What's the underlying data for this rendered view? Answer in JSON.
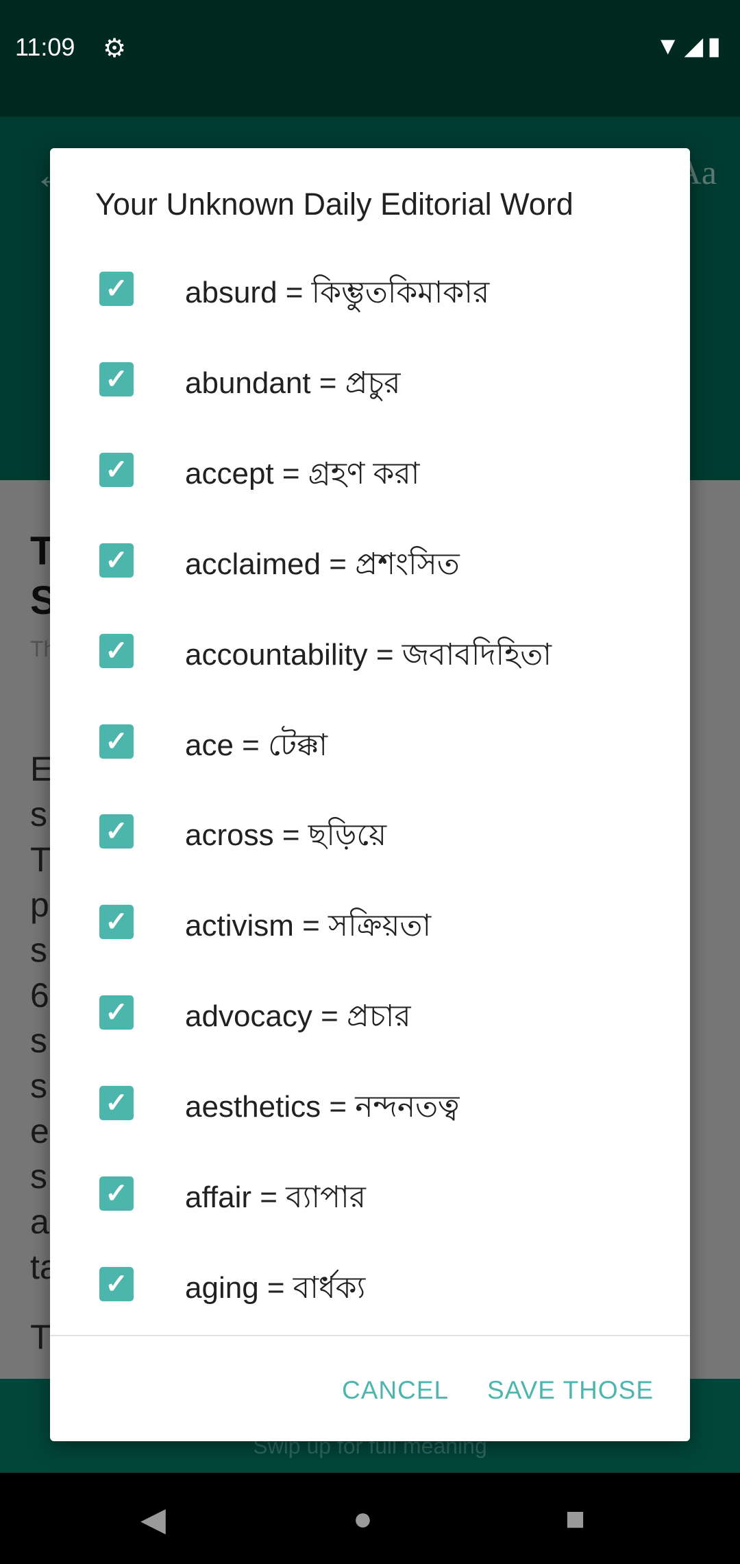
{
  "status_bar": {
    "time": "11:09",
    "settings_icon": "gear-icon",
    "icons": [
      "wifi-icon",
      "signal-icon",
      "battery-icon"
    ]
  },
  "app_bar": {
    "back_icon": "arrow-left-icon",
    "text_size": "Aa"
  },
  "background": {
    "title_fragments": [
      "T",
      "S"
    ],
    "subtitle_fragment": "Th",
    "body_fragments": [
      "E",
      "s",
      "T",
      "p",
      "s",
      "6",
      "s",
      "s",
      "e",
      "s",
      "a",
      "ta"
    ],
    "tail_fragment": "T",
    "bottom_hint": "Swip up for full meaning"
  },
  "dialog": {
    "title": "Your Unknown Daily Editorial Word",
    "items": [
      {
        "label": "absurd = কিম্ভুতকিমাকার",
        "checked": true
      },
      {
        "label": "abundant = প্রচুর",
        "checked": true
      },
      {
        "label": "accept = গ্রহণ করা",
        "checked": true
      },
      {
        "label": "acclaimed = প্রশংসিত",
        "checked": true
      },
      {
        "label": "accountability = জবাবদিহিতা",
        "checked": true
      },
      {
        "label": "ace = টেক্কা",
        "checked": true
      },
      {
        "label": "across = ছড়িয়ে",
        "checked": true
      },
      {
        "label": "activism = সক্রিয়তা",
        "checked": true
      },
      {
        "label": "advocacy = প্রচার",
        "checked": true
      },
      {
        "label": "aesthetics = নন্দনতত্ব",
        "checked": true
      },
      {
        "label": "affair = ব্যাপার",
        "checked": true
      },
      {
        "label": "aging = বার্ধক্য",
        "checked": true
      }
    ],
    "cancel": "CANCEL",
    "save": "SAVE THOSE",
    "accent": "#4db6ac"
  }
}
